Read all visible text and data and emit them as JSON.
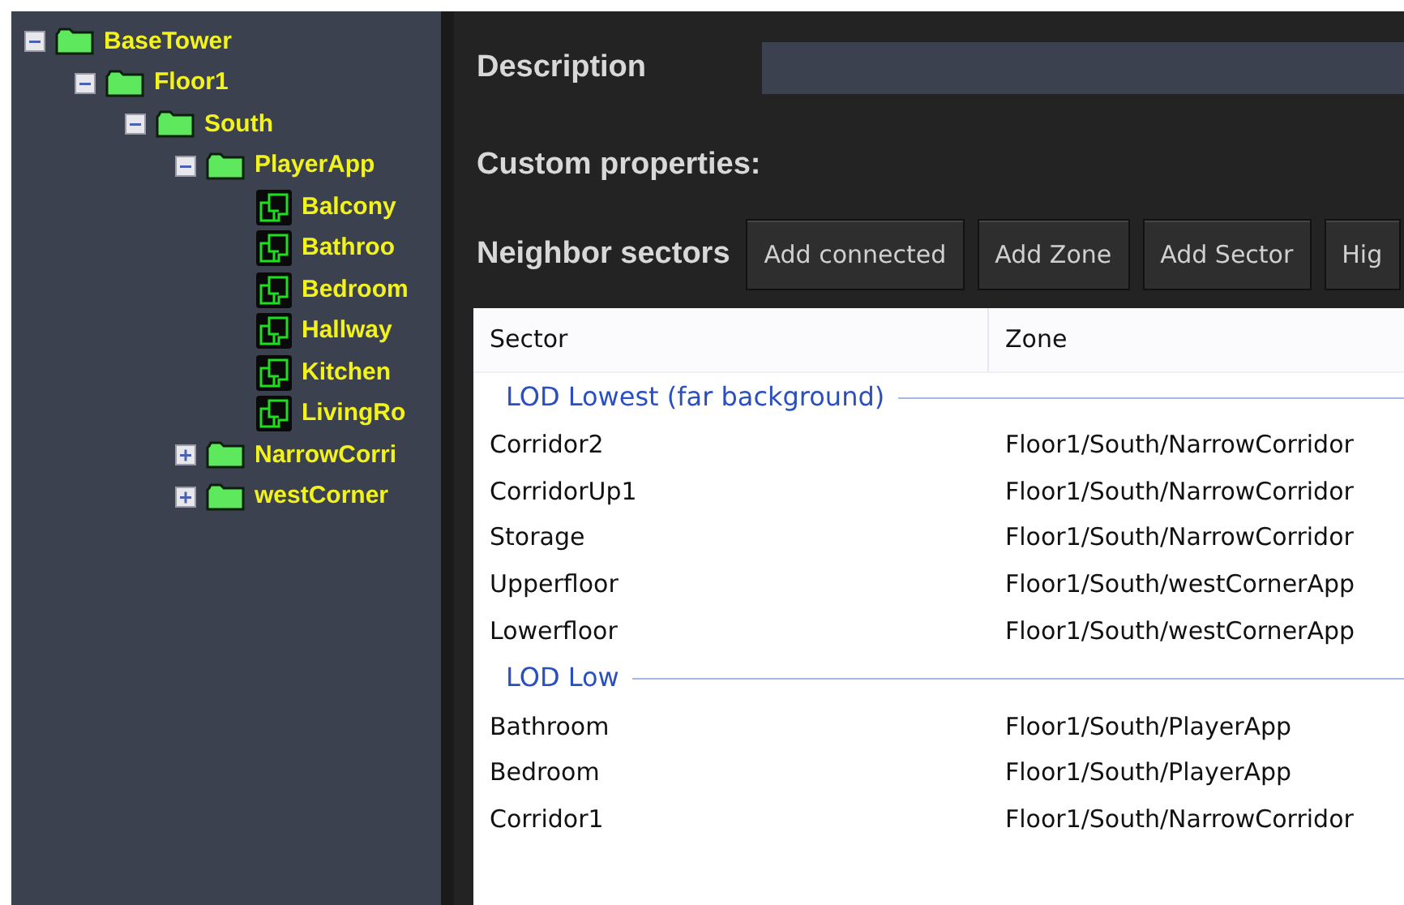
{
  "tree": [
    {
      "label": "BaseTower",
      "kind": "folder",
      "expanded": true,
      "children": [
        {
          "label": "Floor1",
          "kind": "folder",
          "expanded": true,
          "children": [
            {
              "label": "South",
              "kind": "folder",
              "expanded": true,
              "children": [
                {
                  "label": "PlayerApp",
                  "kind": "folder",
                  "expanded": true,
                  "children": [
                    {
                      "label": "Balcony",
                      "kind": "sector"
                    },
                    {
                      "label": "Bathroo",
                      "kind": "sector"
                    },
                    {
                      "label": "Bedroom",
                      "kind": "sector"
                    },
                    {
                      "label": "Hallway",
                      "kind": "sector"
                    },
                    {
                      "label": "Kitchen",
                      "kind": "sector"
                    },
                    {
                      "label": "LivingRo",
                      "kind": "sector"
                    }
                  ]
                },
                {
                  "label": "NarrowCorri",
                  "kind": "folder",
                  "expanded": false
                },
                {
                  "label": "westCorner",
                  "kind": "folder",
                  "expanded": false
                }
              ]
            }
          ]
        }
      ]
    }
  ],
  "description": {
    "label": "Description"
  },
  "custom_properties": {
    "label": "Custom properties:"
  },
  "neighbor_sectors": {
    "label": "Neighbor sectors",
    "buttons": [
      "Add connected",
      "Add Zone",
      "Add Sector",
      "Hig"
    ]
  },
  "table": {
    "columns": [
      "Sector",
      "Zone"
    ],
    "groups": [
      {
        "title": "LOD Lowest (far background)",
        "rows": [
          {
            "sector": "Corridor2",
            "zone": "Floor1/South/NarrowCorridor"
          },
          {
            "sector": "CorridorUp1",
            "zone": "Floor1/South/NarrowCorridor"
          },
          {
            "sector": "Storage",
            "zone": "Floor1/South/NarrowCorridor"
          },
          {
            "sector": "Upperfloor",
            "zone": "Floor1/South/westCornerApp"
          },
          {
            "sector": "Lowerfloor",
            "zone": "Floor1/South/westCornerApp"
          }
        ]
      },
      {
        "title": "LOD Low",
        "rows": [
          {
            "sector": "Bathroom",
            "zone": "Floor1/South/PlayerApp"
          },
          {
            "sector": "Bedroom",
            "zone": "Floor1/South/PlayerApp"
          },
          {
            "sector": "Corridor1",
            "zone": "Floor1/South/NarrowCorridor"
          }
        ]
      }
    ]
  }
}
